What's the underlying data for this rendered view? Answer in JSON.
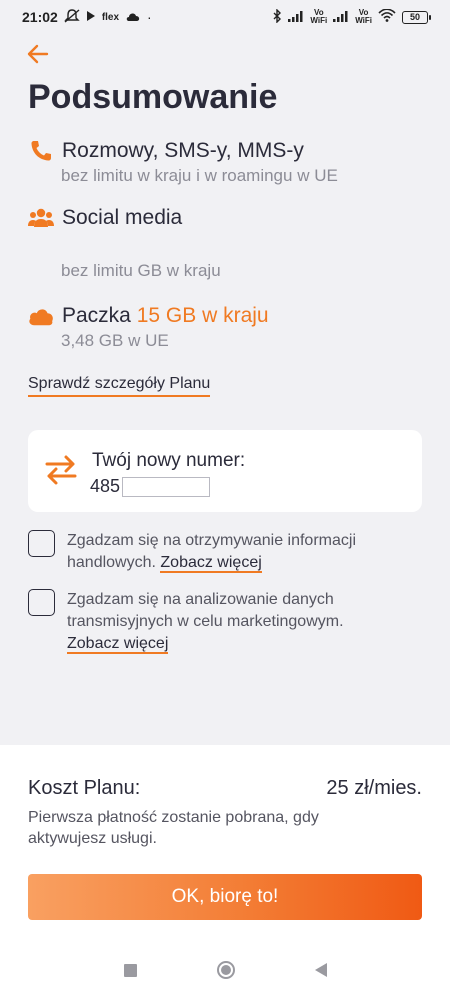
{
  "status_bar": {
    "time": "21:02",
    "carrier_label": "flex",
    "volte1": "Vo\nWiFi",
    "volte2": "Vo\nWiFi",
    "battery": "50"
  },
  "header": {
    "title": "Podsumowanie"
  },
  "features": [
    {
      "title": "Rozmowy, SMS-y, MMS-y",
      "subtitle": "bez limitu w kraju i w roamingu w UE",
      "icon": "phone-icon"
    },
    {
      "title": "Social media",
      "subtitle": "bez limitu GB w kraju",
      "icon": "people-icon"
    },
    {
      "title_prefix": "Paczka ",
      "title_highlight": "15 GB w kraju",
      "subtitle": "3,48 GB w UE",
      "icon": "cloud-icon"
    }
  ],
  "details_link": "Sprawdź szczegóły Planu",
  "number_card": {
    "label": "Twój nowy numer:",
    "value_prefix": "485"
  },
  "consents": [
    {
      "text": "Zgadzam się na otrzymywanie informacji handlowych. ",
      "link": "Zobacz więcej"
    },
    {
      "text": "Zgadzam się na analizowanie danych transmisyjnych w celu marketingowym. ",
      "link": "Zobacz więcej"
    }
  ],
  "summary": {
    "cost_label": "Koszt Planu:",
    "cost_value": "25 zł/mies.",
    "note": "Pierwsza płatność zostanie pobrana, gdy aktywujesz usługi.",
    "cta_label": "OK, biorę to!"
  },
  "colors": {
    "accent": "#f07a22",
    "text": "#2b2b3a",
    "muted": "#8c8c96",
    "background": "#f1f1f4"
  }
}
